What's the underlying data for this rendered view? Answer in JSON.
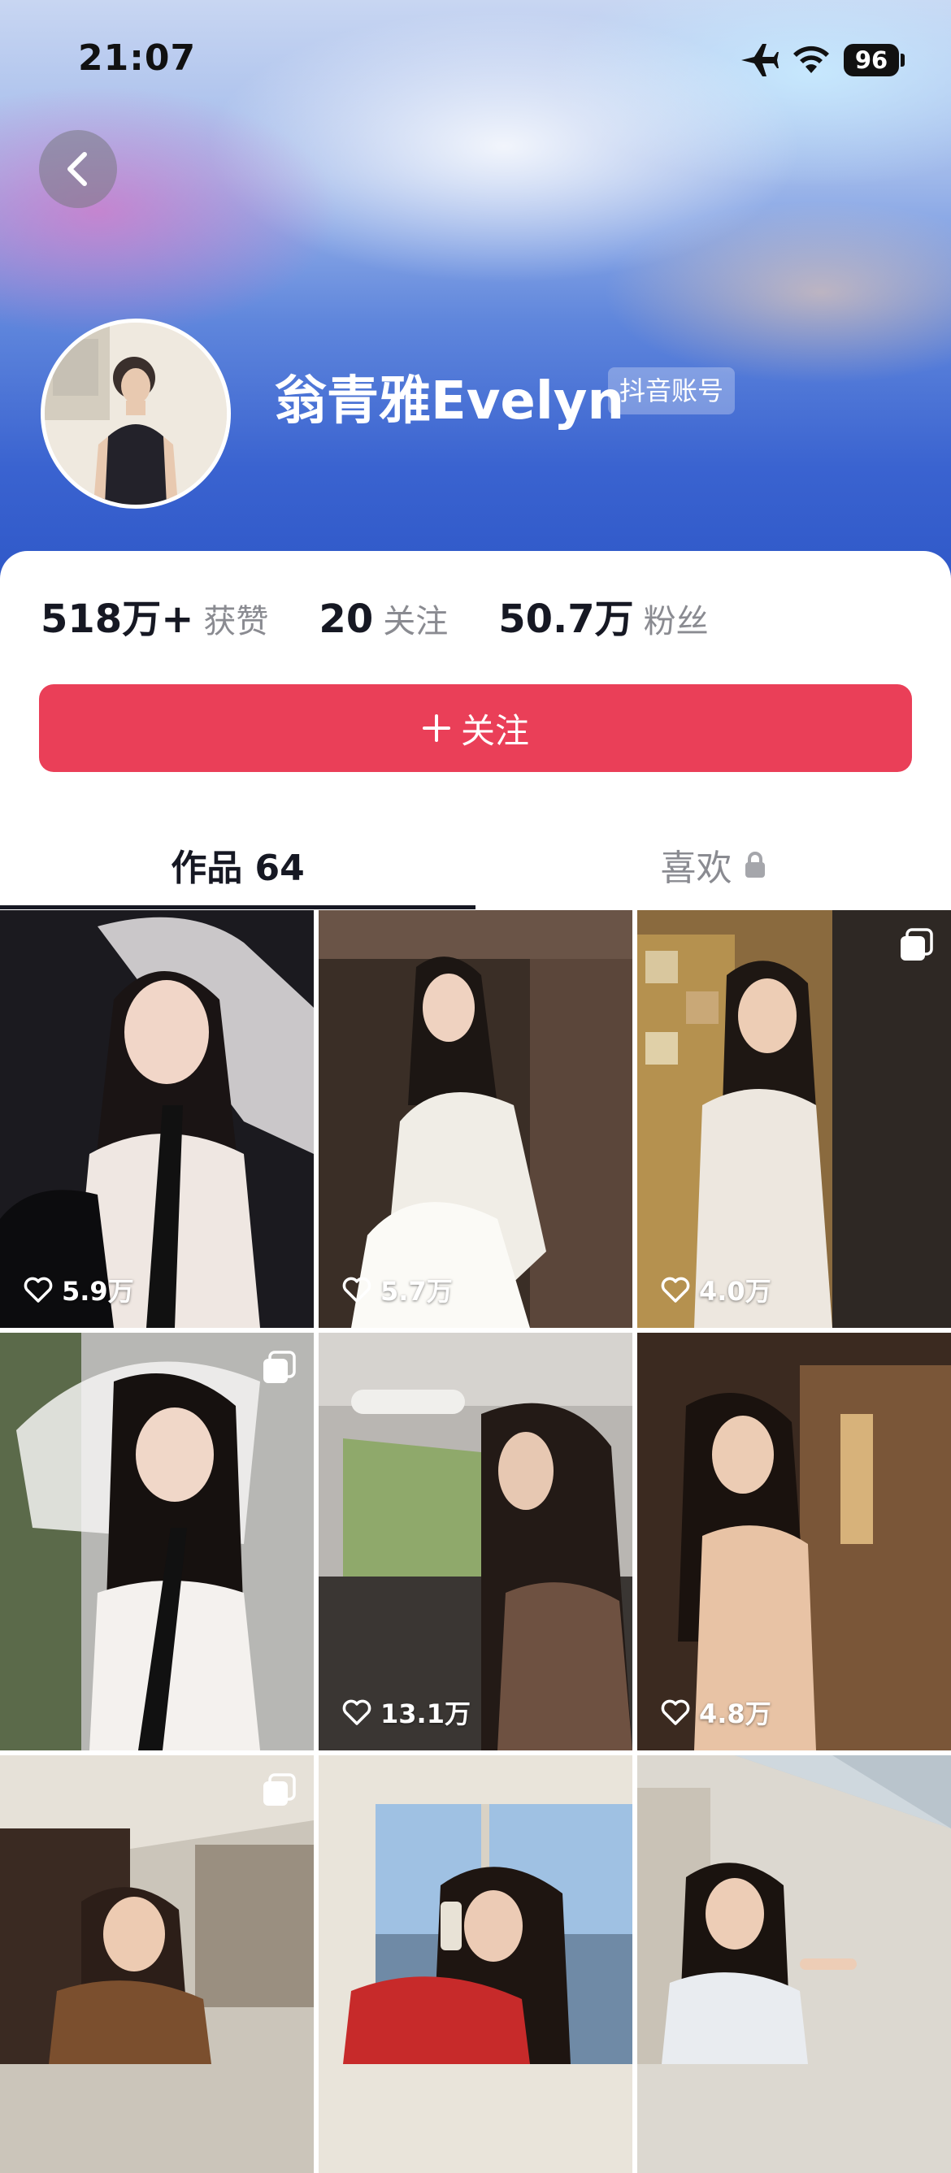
{
  "status_bar": {
    "time": "21:07",
    "battery": "96",
    "icons": [
      "airplane-icon",
      "wifi-icon",
      "battery-icon"
    ]
  },
  "header": {
    "back_icon": "chevron-left-icon"
  },
  "profile": {
    "name": "翁青雅Evelyn",
    "badge": "抖音账号",
    "stats": [
      {
        "value": "518万+",
        "label": "获赞"
      },
      {
        "value": "20",
        "label": "关注"
      },
      {
        "value": "50.7万",
        "label": "粉丝"
      }
    ],
    "follow_label": "关注"
  },
  "tabs": [
    {
      "label": "作品 64",
      "active": true
    },
    {
      "label": "喜欢",
      "active": false,
      "icon": "lock-icon"
    }
  ],
  "videos": [
    {
      "likes": "5.9万",
      "multi": false
    },
    {
      "likes": "5.7万",
      "multi": false
    },
    {
      "likes": "4.0万",
      "multi": true
    },
    {
      "likes": "",
      "multi": true
    },
    {
      "likes": "13.1万",
      "multi": false
    },
    {
      "likes": "4.8万",
      "multi": false
    },
    {
      "likes": "",
      "multi": true
    },
    {
      "likes": "",
      "multi": false
    },
    {
      "likes": "",
      "multi": false
    }
  ],
  "colors": {
    "accent": "#ea3f58",
    "text_primary": "#161823",
    "text_secondary": "#8a8b91"
  }
}
